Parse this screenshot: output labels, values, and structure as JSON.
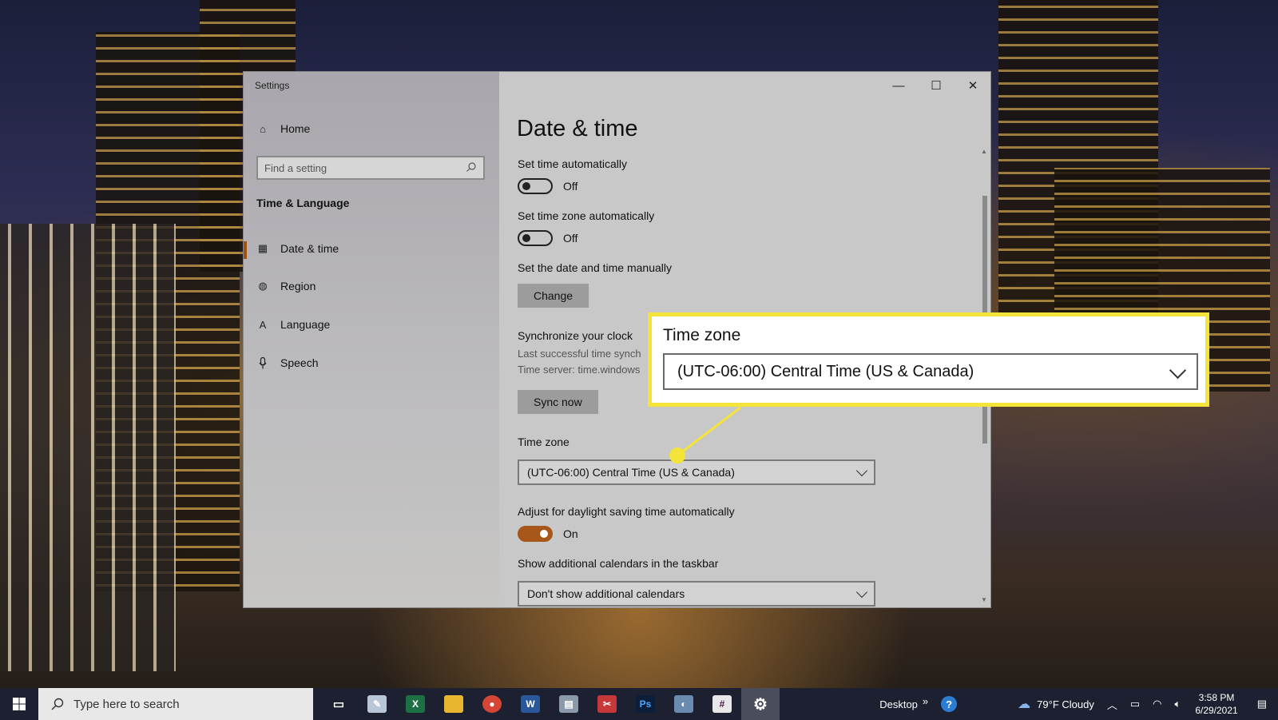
{
  "window": {
    "title": "Settings",
    "controls": {
      "minimize": "—",
      "maximize": "☐",
      "close": "✕"
    }
  },
  "sidebar": {
    "home": "Home",
    "search_placeholder": "Find a setting",
    "section": "Time & Language",
    "items": [
      {
        "label": "Date & time",
        "icon": "calendar-clock-icon",
        "active": true
      },
      {
        "label": "Region",
        "icon": "globe-icon"
      },
      {
        "label": "Language",
        "icon": "language-icon"
      },
      {
        "label": "Speech",
        "icon": "microphone-icon"
      }
    ]
  },
  "main": {
    "title": "Date & time",
    "set_time_auto": {
      "label": "Set time automatically",
      "state": "Off"
    },
    "set_tz_auto": {
      "label": "Set time zone automatically",
      "state": "Off"
    },
    "manual": {
      "label": "Set the date and time manually",
      "button": "Change"
    },
    "sync": {
      "label": "Synchronize your clock",
      "line1": "Last successful time synch",
      "line2": "Time server: time.windows",
      "button": "Sync now"
    },
    "timezone": {
      "label": "Time zone",
      "value": "(UTC-06:00) Central Time (US & Canada)"
    },
    "dst": {
      "label": "Adjust for daylight saving time automatically",
      "state": "On"
    },
    "calendars": {
      "label": "Show additional calendars in the taskbar",
      "value": "Don't show additional calendars"
    }
  },
  "callout": {
    "title": "Time zone",
    "value": "(UTC-06:00) Central Time (US & Canada)",
    "color": "#f4e43a"
  },
  "taskbar": {
    "search_placeholder": "Type here to search",
    "desktop_label": "Desktop",
    "chevrons": "»",
    "weather": "79°F  Cloudy",
    "time": "3:58 PM",
    "date": "6/29/2021"
  },
  "colors": {
    "accent": "#a8571a",
    "highlight": "#f4e43a"
  }
}
